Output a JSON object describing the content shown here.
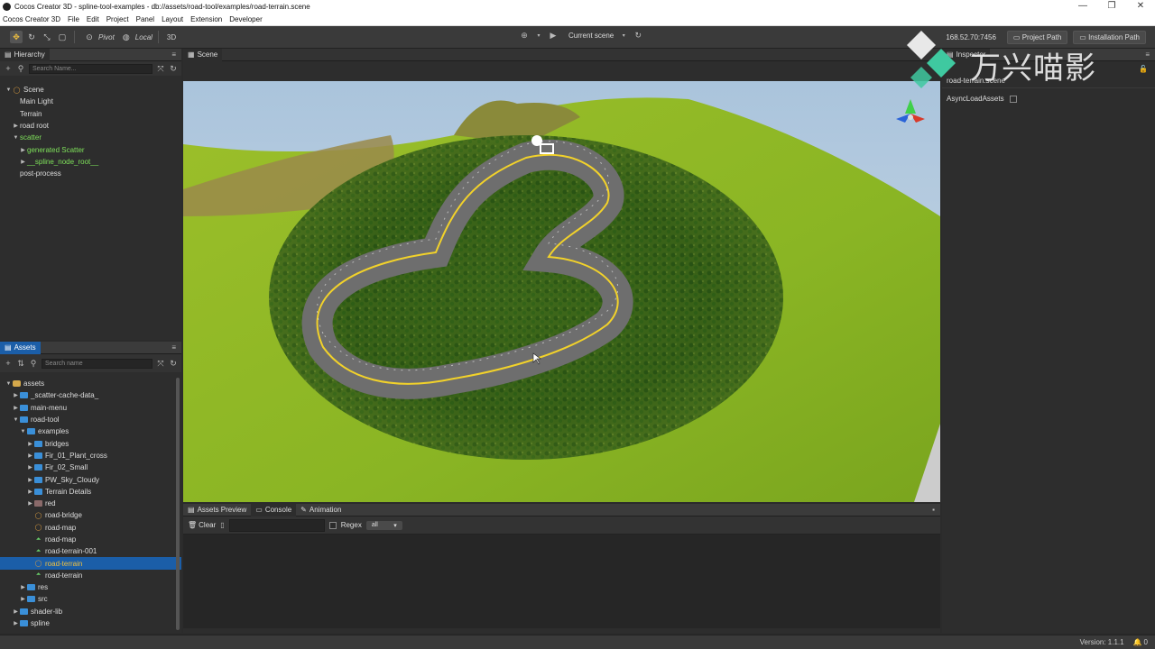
{
  "window": {
    "title": "Cocos Creator 3D - spline-tool-examples - db://assets/road-tool/examples/road-terrain.scene",
    "controls": [
      "—",
      "❐",
      "✕"
    ]
  },
  "menubar": [
    "Cocos Creator 3D",
    "File",
    "Edit",
    "Project",
    "Panel",
    "Layout",
    "Extension",
    "Developer"
  ],
  "toolbar": {
    "pivot_label": "Pivot",
    "local_label": "Local",
    "mode_3d": "3D",
    "scene_select": "Current scene",
    "ip": "168.52.70:7456",
    "project_path": "Project Path",
    "installation_path": "Installation Path"
  },
  "hierarchy": {
    "tab": "Hierarchy",
    "search_placeholder": "Search Name...",
    "items": [
      {
        "label": "Scene",
        "depth": 0,
        "expanded": true,
        "icon": "scene"
      },
      {
        "label": "Main Light",
        "depth": 1
      },
      {
        "label": "Terrain",
        "depth": 1
      },
      {
        "label": "road root",
        "depth": 1,
        "collapsed": true
      },
      {
        "label": "scatter",
        "depth": 1,
        "expanded": true,
        "green": true
      },
      {
        "label": "generated Scatter",
        "depth": 2,
        "collapsed": true,
        "green": true
      },
      {
        "label": "__spline_node_root__",
        "depth": 2,
        "collapsed": true,
        "green": true
      },
      {
        "label": "post-process",
        "depth": 1
      }
    ]
  },
  "assets": {
    "tab": "Assets",
    "search_placeholder": "Search name",
    "items": [
      {
        "label": "assets",
        "depth": 0,
        "expanded": true,
        "icon": "db"
      },
      {
        "label": "_scatter-cache-data_",
        "depth": 1,
        "collapsed": true,
        "icon": "folder"
      },
      {
        "label": "main-menu",
        "depth": 1,
        "collapsed": true,
        "icon": "folder"
      },
      {
        "label": "road-tool",
        "depth": 1,
        "expanded": true,
        "icon": "folder"
      },
      {
        "label": "examples",
        "depth": 2,
        "expanded": true,
        "icon": "folder"
      },
      {
        "label": "bridges",
        "depth": 3,
        "collapsed": true,
        "icon": "folder"
      },
      {
        "label": "Fir_01_Plant_cross",
        "depth": 3,
        "collapsed": true,
        "icon": "folder"
      },
      {
        "label": "Fir_02_Small",
        "depth": 3,
        "collapsed": true,
        "icon": "folder"
      },
      {
        "label": "PW_Sky_Cloudy",
        "depth": 3,
        "collapsed": true,
        "icon": "folder"
      },
      {
        "label": "Terrain Details",
        "depth": 3,
        "collapsed": true,
        "icon": "folder"
      },
      {
        "label": "red",
        "depth": 3,
        "collapsed": true,
        "icon": "folder-red"
      },
      {
        "label": "road-bridge",
        "depth": 3,
        "icon": "scene"
      },
      {
        "label": "road-map",
        "depth": 3,
        "icon": "scene"
      },
      {
        "label": "road-map",
        "depth": 3,
        "icon": "mesh"
      },
      {
        "label": "road-terrain-001",
        "depth": 3,
        "icon": "mesh"
      },
      {
        "label": "road-terrain",
        "depth": 3,
        "icon": "scene",
        "selected": true
      },
      {
        "label": "road-terrain",
        "depth": 3,
        "icon": "mesh"
      },
      {
        "label": "res",
        "depth": 2,
        "collapsed": true,
        "icon": "folder"
      },
      {
        "label": "src",
        "depth": 2,
        "collapsed": true,
        "icon": "folder"
      },
      {
        "label": "shader-lib",
        "depth": 1,
        "collapsed": true,
        "icon": "folder"
      },
      {
        "label": "spline",
        "depth": 1,
        "collapsed": true,
        "icon": "folder"
      }
    ]
  },
  "scene": {
    "tab": "Scene"
  },
  "bottom": {
    "tabs": [
      "Assets Preview",
      "Console",
      "Animation"
    ],
    "active_tab": "Console",
    "clear_label": "Clear",
    "regex_label": "Regex",
    "filter_value": "all"
  },
  "inspector": {
    "tab": "Inspector",
    "asset_name": "road-terrain.scene",
    "field_label": "AsyncLoadAssets"
  },
  "status": {
    "version": "Version: 1.1.1",
    "notifications": "0"
  },
  "watermark": {
    "text": "万兴喵影"
  },
  "colors": {
    "selection_blue": "#1b5ea8",
    "scatter_green": "#7ee05a",
    "terrain_green": "#8ab52a",
    "road_gray": "#7a7a7a",
    "road_line_yellow": "#f2d22a"
  }
}
